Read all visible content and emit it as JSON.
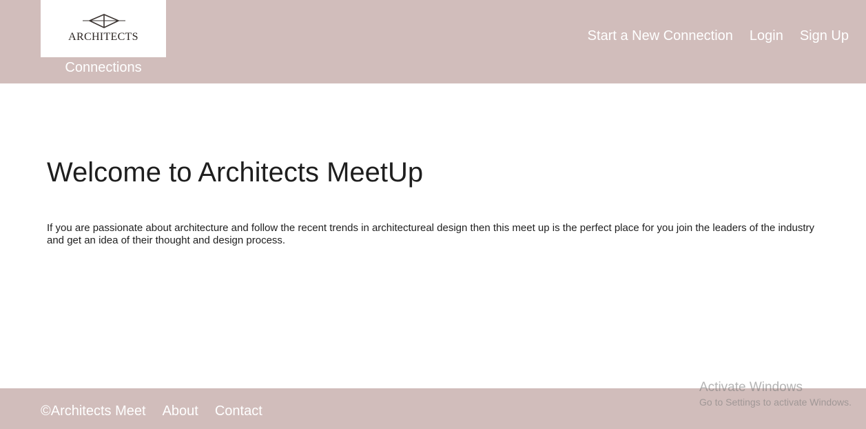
{
  "header": {
    "logo_text": "ARCHITECTS",
    "site_name": "Connections",
    "nav": [
      "Start a New Connection",
      "Login",
      "Sign Up"
    ]
  },
  "main": {
    "title": "Welcome to Architects MeetUp",
    "description": "If you are passionate about architecture and follow the recent trends in architectureal design then this meet up is the perfect place for you join the leaders of the industry and get an idea of their thought and design process."
  },
  "footer": {
    "copyright": "©Architects Meet",
    "links": [
      "About",
      "Contact"
    ]
  },
  "watermark": {
    "line1": "Activate Windows",
    "line2": "Go to Settings to activate Windows."
  },
  "colors": {
    "header_bg": "#d1bdbb",
    "footer_bg": "#d1bdbb",
    "nav_text": "#ffffff"
  }
}
